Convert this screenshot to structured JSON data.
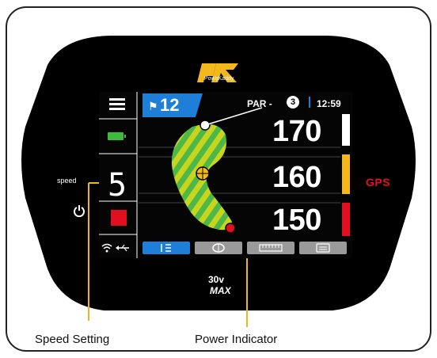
{
  "brand": {
    "logo_text": "PowaKaddy",
    "model_line1": "30v",
    "model_line2": "MAX"
  },
  "hole": {
    "number": "12",
    "par_label": "PAR -",
    "par_value": "3",
    "time": "12:59"
  },
  "distances": [
    {
      "value": "170",
      "color": "#ffffff"
    },
    {
      "value": "160",
      "color": "#f4b81c"
    },
    {
      "value": "150",
      "color": "#e01020"
    }
  ],
  "speed": {
    "label": "speed",
    "value": "5"
  },
  "gps_label": "GPS",
  "tabs": [
    {
      "icon": "hole-info-icon",
      "active": true
    },
    {
      "icon": "green-view-icon",
      "active": false
    },
    {
      "icon": "ruler-icon",
      "active": false
    },
    {
      "icon": "scorecard-icon",
      "active": false
    }
  ],
  "annotations": {
    "speed_setting": "Speed Setting",
    "power_indicator": "Power Indicator"
  },
  "colors": {
    "accent_blue": "#1e7fd8",
    "fairway_green": "#4db848",
    "fairway_stripe": "#c8d51e",
    "power_red": "#e01020",
    "battery_green": "#3dbb3d",
    "annotation_line": "#f2b41f"
  }
}
